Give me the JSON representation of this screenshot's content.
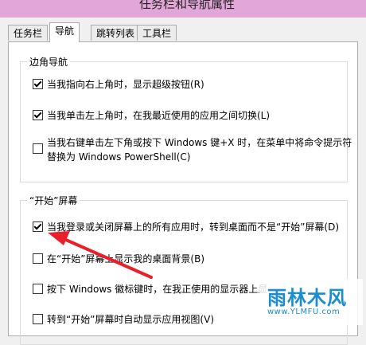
{
  "window": {
    "title": "任务栏和导航属性"
  },
  "tabs": [
    {
      "label": "任务栏",
      "active": false
    },
    {
      "label": "导航",
      "active": true
    },
    {
      "label": "跳转列表",
      "active": false
    },
    {
      "label": "工具栏",
      "active": false
    }
  ],
  "corner_nav": {
    "legend": "边角导航",
    "options": [
      {
        "label": "当我指向右上角时，显示超级按钮(R)",
        "checked": true
      },
      {
        "label": "当我单击左上角时，在我最近使用的应用之间切换(L)",
        "checked": true
      },
      {
        "label_line1": "当我右键单击左下角或按下 Windows 键+X 时，在菜单中将命令提示符",
        "label_line2": "替换为 Windows PowerShell(C)",
        "checked": false
      }
    ]
  },
  "start_screen": {
    "legend": "“开始”屏幕",
    "options": [
      {
        "label": "当我登录或关闭屏幕上的所有应用时，转到桌面而不是“开始”屏幕(D)",
        "checked": true
      },
      {
        "label": "在“开始”屏幕上显示我的桌面背景(B)",
        "checked": false
      },
      {
        "label": "按下 Windows 徽标键时，在我正使用的显示器上显",
        "checked": false
      },
      {
        "label": "转到“开始”屏幕时自动显示应用视图(V)",
        "checked": false
      }
    ]
  },
  "watermark": {
    "name": "雨林木风",
    "url": "www.YLMFU.com"
  },
  "colors": {
    "titlebar": "#e3a6d8",
    "arrow": "#e8202a",
    "watermark": "#1a8ccf"
  }
}
